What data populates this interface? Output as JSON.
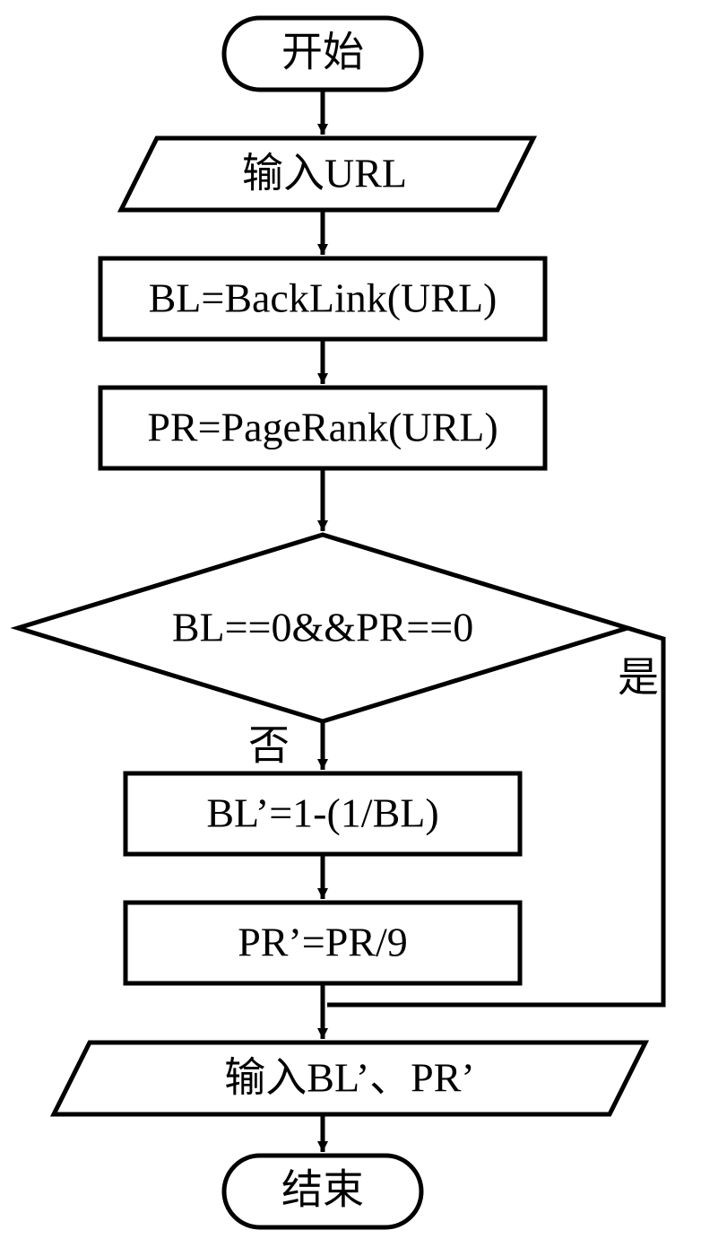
{
  "flowchart": {
    "start": "开始",
    "input": "输入URL",
    "proc1": "BL=BackLink(URL)",
    "proc2": "PR=PageRank(URL)",
    "decision": "BL==0&&PR==0",
    "branch_yes": "是",
    "branch_no": "否",
    "proc3": "BL’=1-(1/BL)",
    "proc4": "PR’=PR/9",
    "output": "输入BL’、PR’",
    "end": "结束"
  }
}
